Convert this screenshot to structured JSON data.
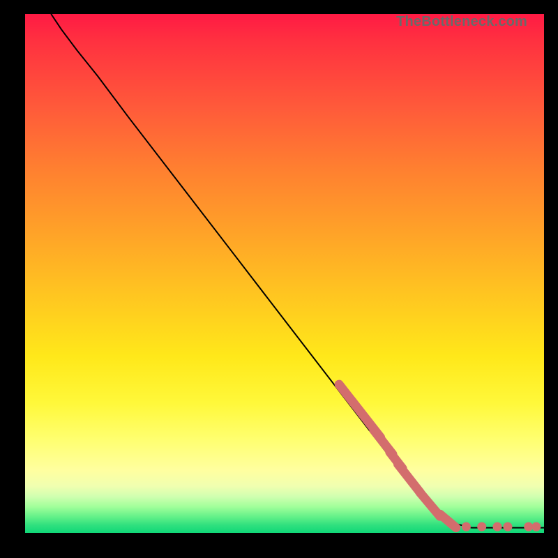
{
  "watermark": "TheBottleneck.com",
  "chart_data": {
    "type": "line",
    "title": "",
    "xlabel": "",
    "ylabel": "",
    "xlim": [
      0,
      100
    ],
    "ylim": [
      0,
      100
    ],
    "curve": [
      {
        "x": 5,
        "y": 100
      },
      {
        "x": 7,
        "y": 97
      },
      {
        "x": 10,
        "y": 93
      },
      {
        "x": 14,
        "y": 88
      },
      {
        "x": 20,
        "y": 80
      },
      {
        "x": 30,
        "y": 67
      },
      {
        "x": 40,
        "y": 54
      },
      {
        "x": 50,
        "y": 41
      },
      {
        "x": 60,
        "y": 28
      },
      {
        "x": 70,
        "y": 15
      },
      {
        "x": 78,
        "y": 5
      },
      {
        "x": 82,
        "y": 2
      },
      {
        "x": 86,
        "y": 1
      },
      {
        "x": 90,
        "y": 1
      },
      {
        "x": 100,
        "y": 1
      }
    ],
    "dot_clusters": [
      {
        "cx": 64.5,
        "cy": 23.5,
        "len": 6.5,
        "angle": -52
      },
      {
        "cx": 69.0,
        "cy": 17.5,
        "len": 3.0,
        "angle": -52
      },
      {
        "cx": 71.5,
        "cy": 14.0,
        "len": 2.0,
        "angle": -52
      },
      {
        "cx": 74.0,
        "cy": 10.5,
        "len": 3.5,
        "angle": -52
      },
      {
        "cx": 78.0,
        "cy": 5.5,
        "len": 3.0,
        "angle": -50
      },
      {
        "cx": 81.5,
        "cy": 2.3,
        "len": 2.0,
        "angle": -40
      }
    ],
    "dots_flat": [
      {
        "x": 85.0,
        "y": 1.2
      },
      {
        "x": 88.0,
        "y": 1.2
      },
      {
        "x": 91.0,
        "y": 1.2
      },
      {
        "x": 93.0,
        "y": 1.2
      },
      {
        "x": 97.0,
        "y": 1.2
      },
      {
        "x": 98.5,
        "y": 1.2
      }
    ],
    "colors": {
      "dot": "#d36d6d",
      "curve": "#000000"
    }
  }
}
